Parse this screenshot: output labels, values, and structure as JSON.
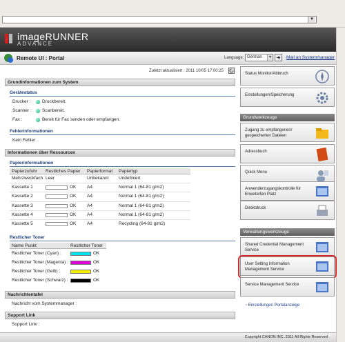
{
  "header": {
    "brand": "imageRUNNER",
    "brand_sub": "ADVANCE",
    "title": "Remote UI : Portal",
    "language_label": "Language:",
    "language_value": "German",
    "mail_link": "Mail an Systemmanager"
  },
  "main": {
    "updated": "Zuletzt aktualisiert : 2011 10/05 17:00:25",
    "grundinfo": "Grundinformationen zum System",
    "geraetestatus": "Gerätestatus",
    "status": [
      {
        "label": "Drucker :",
        "value": "Druckbereit."
      },
      {
        "label": "Scanner :",
        "value": "Scanbereit."
      },
      {
        "label": "Fax :",
        "value": "Bereit für Fax senden oder empfangen."
      }
    ],
    "fehlerinfo": "Fehlerinformationen",
    "kein_fehler": "Kein Fehler",
    "ressourcen": "Informationen über Ressourcen",
    "papierinfo": "Papierinformationen",
    "paper_headers": [
      "Papierzufuhr",
      "Restliches Papier",
      "Papierformat",
      "Papiertyp"
    ],
    "paper_rows": [
      {
        "source": "Mehrzweckfach",
        "remaining": "Leer",
        "level": null,
        "format": "Unbekannt",
        "type": "Undefiniert"
      },
      {
        "source": "Kassette 1",
        "remaining": "OK",
        "level": 1.0,
        "format": "A4",
        "type": "Normal 1 (64-81 g/m2)"
      },
      {
        "source": "Kassette 2",
        "remaining": "OK",
        "level": 1.0,
        "format": "A4",
        "type": "Normal 1 (64-81 g/m2)"
      },
      {
        "source": "Kassette 3",
        "remaining": "OK",
        "level": 1.0,
        "format": "A4",
        "type": "Normal 1 (64-81 g/m2)"
      },
      {
        "source": "Kassette 4",
        "remaining": "OK",
        "level": 1.0,
        "format": "A4",
        "type": "Normal 1 (64-81 g/m2)"
      },
      {
        "source": "Kassette 5",
        "remaining": "OK",
        "level": 1.0,
        "format": "A4",
        "type": "Recycling (64-81 g/m2)"
      }
    ],
    "restlicher_toner": "Restlicher Toner",
    "toner_headers": [
      "Name Punkt",
      "Restlicher Toner"
    ],
    "toner_rows": [
      {
        "name": "Restlicher Toner (Cyan) :",
        "value": "OK",
        "color": "#00e5f0"
      },
      {
        "name": "Restlicher Toner (Magenta) :",
        "value": "OK",
        "color": "#e000d8"
      },
      {
        "name": "Restlicher Toner (Gelb) :",
        "value": "OK",
        "color": "#f5ef00"
      },
      {
        "name": "Restlicher Toner (Schwarz) :",
        "value": "OK",
        "color": "#000000"
      }
    ],
    "nachrichtentafel": "Nachrichtentafel",
    "nachricht_label": "Nachricht vom Systemmanager :",
    "support_link": "Support Link",
    "support_label": "Support Link :"
  },
  "right": {
    "top_items": [
      {
        "label": "Status Monitor/Abbruch",
        "icon": "status-monitor-icon"
      },
      {
        "label": "Einstellungen/Speicherung",
        "icon": "settings-icon"
      }
    ],
    "grundwerkzeuge": "Grundwerkzeuge",
    "tools": [
      {
        "label": "Zugang zu empfangenen/ gespeicherten Dateien",
        "icon": "folder-icon"
      },
      {
        "label": "Adressbuch",
        "icon": "address-book-icon"
      },
      {
        "label": "Quick Menu",
        "icon": "quick-menu-icon"
      },
      {
        "label": "Anwenderzugangskontrolle für Erweiterten Platz",
        "icon": "access-control-icon"
      },
      {
        "label": "Direktdruck",
        "icon": "printer-icon"
      }
    ],
    "verwaltungswerkzeuge": "Verwaltungswerkzeuge",
    "admin_tools": [
      {
        "label": "Shared Credential Management Service",
        "icon": "window-icon"
      },
      {
        "label": "User Setting Information Management Service",
        "icon": "window-icon"
      },
      {
        "label": "Service Management Service",
        "icon": "window-icon"
      }
    ],
    "portal_link": "Einstellungen Portalanzeige"
  },
  "footer": {
    "copyright": "Copyright CANON INC. 2011 All Rights Reserved"
  },
  "colors": {
    "accent_blue": "#1b3c78",
    "highlight_red": "#d4282a",
    "status_green": "#14a06e"
  }
}
